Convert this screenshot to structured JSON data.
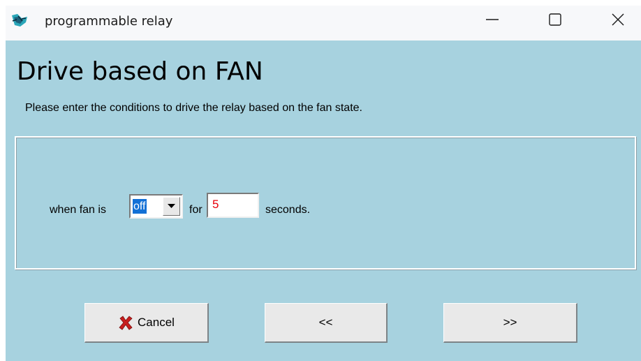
{
  "window": {
    "title": "programmable relay"
  },
  "page": {
    "title": "Drive based on FAN",
    "subtitle": "Please enter the conditions to drive the relay based on the fan state."
  },
  "condition": {
    "when_label": "when fan is",
    "state_value": "off",
    "for_label": "for",
    "seconds_value": "5",
    "seconds_label": "seconds."
  },
  "buttons": {
    "cancel_label": "Cancel",
    "back_label": "<<",
    "next_label": ">>"
  },
  "icons": {
    "app": "relay-app-icon",
    "minimize": "minimize-icon",
    "maximize": "maximize-icon",
    "close": "close-icon",
    "dropdown": "chevron-down-icon",
    "cancel": "red-x-icon"
  },
  "colors": {
    "background": "#a7d2df",
    "selection": "#1270d6",
    "seconds_value": "#e8000b",
    "cancel_icon": "#c81e1e"
  }
}
